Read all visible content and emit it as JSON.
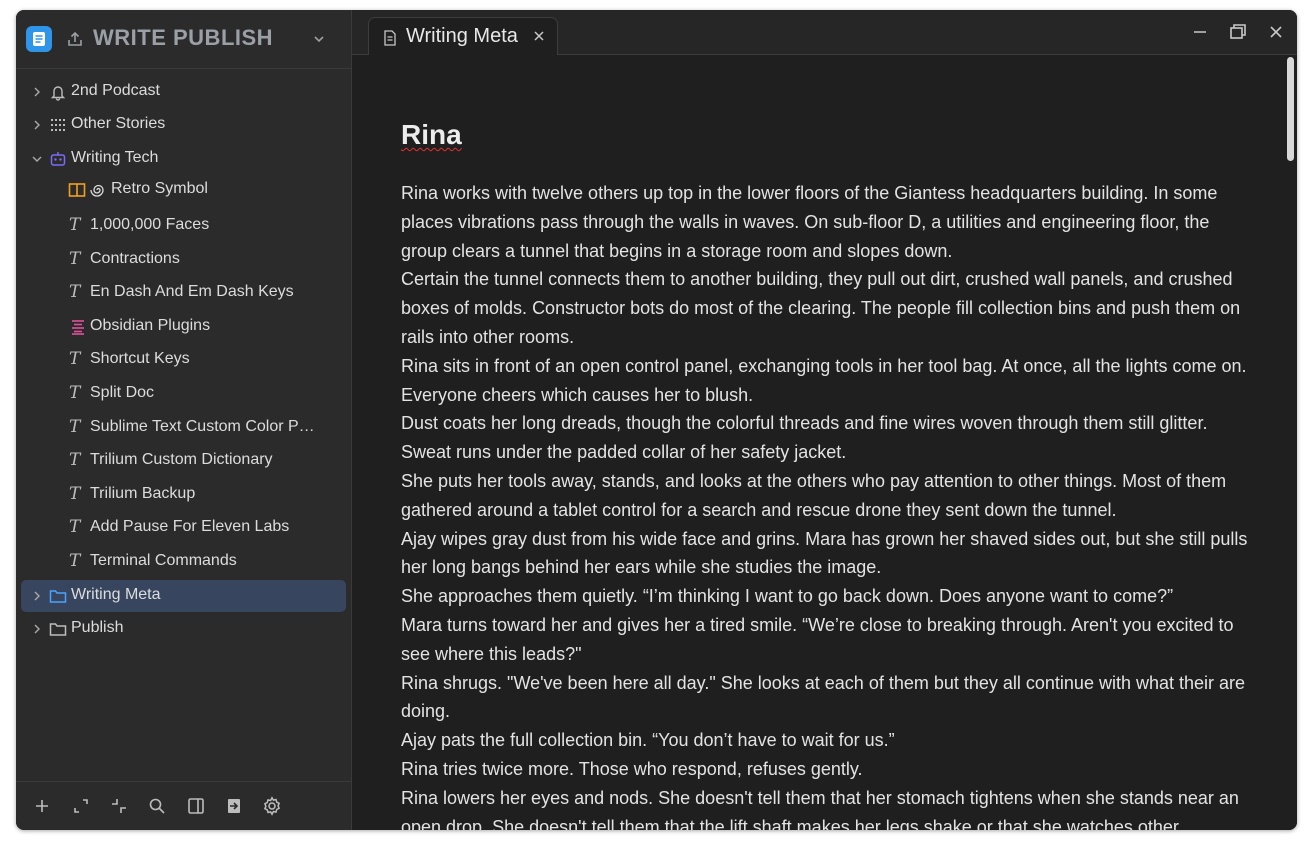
{
  "workspace": {
    "title": "WRITE PUBLISH"
  },
  "tree": [
    {
      "label": "2nd Podcast",
      "icon": "bell-icon"
    },
    {
      "label": "Other Stories",
      "icon": "grid-dots-icon"
    },
    {
      "label": "Writing Tech",
      "icon": "robot-icon"
    },
    {
      "label": "Retro Symbol",
      "icon": "book-open-icon"
    },
    {
      "label": "1,000,000 Faces",
      "icon": "text-note-icon"
    },
    {
      "label": "Contractions",
      "icon": "text-note-icon"
    },
    {
      "label": "En Dash And Em Dash Keys",
      "icon": "text-note-icon"
    },
    {
      "label": "Obsidian Plugins",
      "icon": "list-icon"
    },
    {
      "label": "Shortcut Keys",
      "icon": "text-note-icon"
    },
    {
      "label": "Split Doc",
      "icon": "text-note-icon"
    },
    {
      "label": "Sublime Text Custom Color P…",
      "icon": "text-note-icon"
    },
    {
      "label": "Trilium Custom Dictionary",
      "icon": "text-note-icon"
    },
    {
      "label": "Trilium Backup",
      "icon": "text-note-icon"
    },
    {
      "label": "Add Pause For Eleven Labs",
      "icon": "text-note-icon"
    },
    {
      "label": "Terminal Commands",
      "icon": "text-note-icon"
    },
    {
      "label": "Writing Meta",
      "icon": "folder-icon"
    },
    {
      "label": "Publish",
      "icon": "folder-icon"
    }
  ],
  "tab": {
    "label": "Writing Meta"
  },
  "document": {
    "title": "Rina",
    "paragraphs": [
      "Rina works with twelve others up top in the lower floors of the Giantess headquarters building. In some places vibrations pass through the walls in waves. On sub-floor D, a utilities and engineering floor, the group clears a tunnel that begins in a storage room and slopes down.",
      "Certain the tunnel connects them to another building, they pull out dirt, crushed wall panels, and crushed boxes of molds. Constructor bots do most of the clearing. The people fill collection bins and push them on rails into other rooms.",
      "Rina sits in front of an open control panel, exchanging tools in her tool bag. At once, all the lights come on. Everyone cheers which causes her to blush.",
      "Dust coats her long dreads, though the colorful threads and fine wires woven through them still glitter. Sweat runs under the padded collar of her safety jacket.",
      "She puts her tools away, stands, and looks at the others who pay attention to other things. Most of them gathered around a tablet control for a search and rescue drone they sent down the tunnel.",
      "Ajay wipes gray dust from his wide face and grins. Mara has grown her shaved sides out, but she still pulls her long bangs behind her ears while she studies the image.",
      "She approaches them quietly. “I’m thinking I want to go back down. Does anyone want to come?”",
      "Mara turns toward her and gives her a tired smile. “We’re close to breaking through. Aren't you excited to see where this leads?\"",
      "Rina shrugs. \"We've been here all day.\" She looks at each of them but they all continue with what their are doing.",
      "Ajay pats the full collection bin. “You don’t have to wait for us.”",
      "Rina tries twice more. Those who respond, refuses gently.",
      "Rina lowers her eyes and nods. She doesn't tell them that her stomach tightens when she stands near an open drop. She doesn't tell them that the lift shaft makes her legs shake or that she watches other"
    ]
  },
  "colors": {
    "window_bg": "#242424",
    "sidebar_bg": "#2b2b2b",
    "active_row": "#37465e",
    "accent_blue": "#4aa3ff",
    "robot_purple": "#7b6cf6",
    "book_orange": "#f0a020",
    "list_pink": "#e0509a"
  }
}
